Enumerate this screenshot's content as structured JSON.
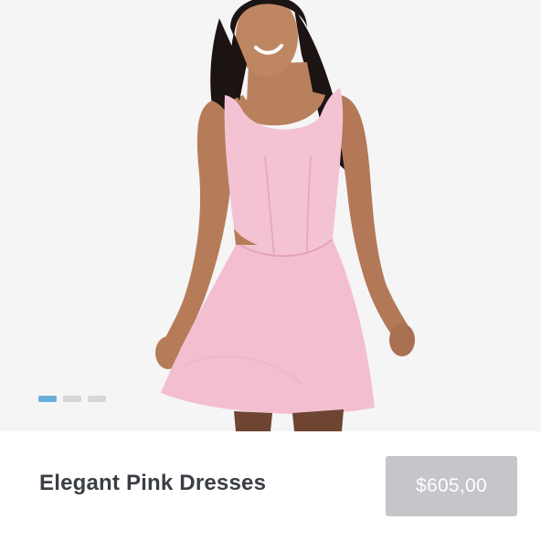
{
  "product": {
    "title": "Elegant Pink Dresses",
    "price": "$605,00",
    "image_alt": "Model wearing a pink sleeveless skater dress"
  },
  "slider": {
    "count": 3,
    "active_index": 0
  },
  "colors": {
    "image_background": "#f5f5f6",
    "dress_pink": "#f4c3d3",
    "active_dot": "#6aaedc",
    "inactive_dot": "#d7d7d9",
    "price_button": "#c5c5ca",
    "title_text": "#3a3e44"
  }
}
